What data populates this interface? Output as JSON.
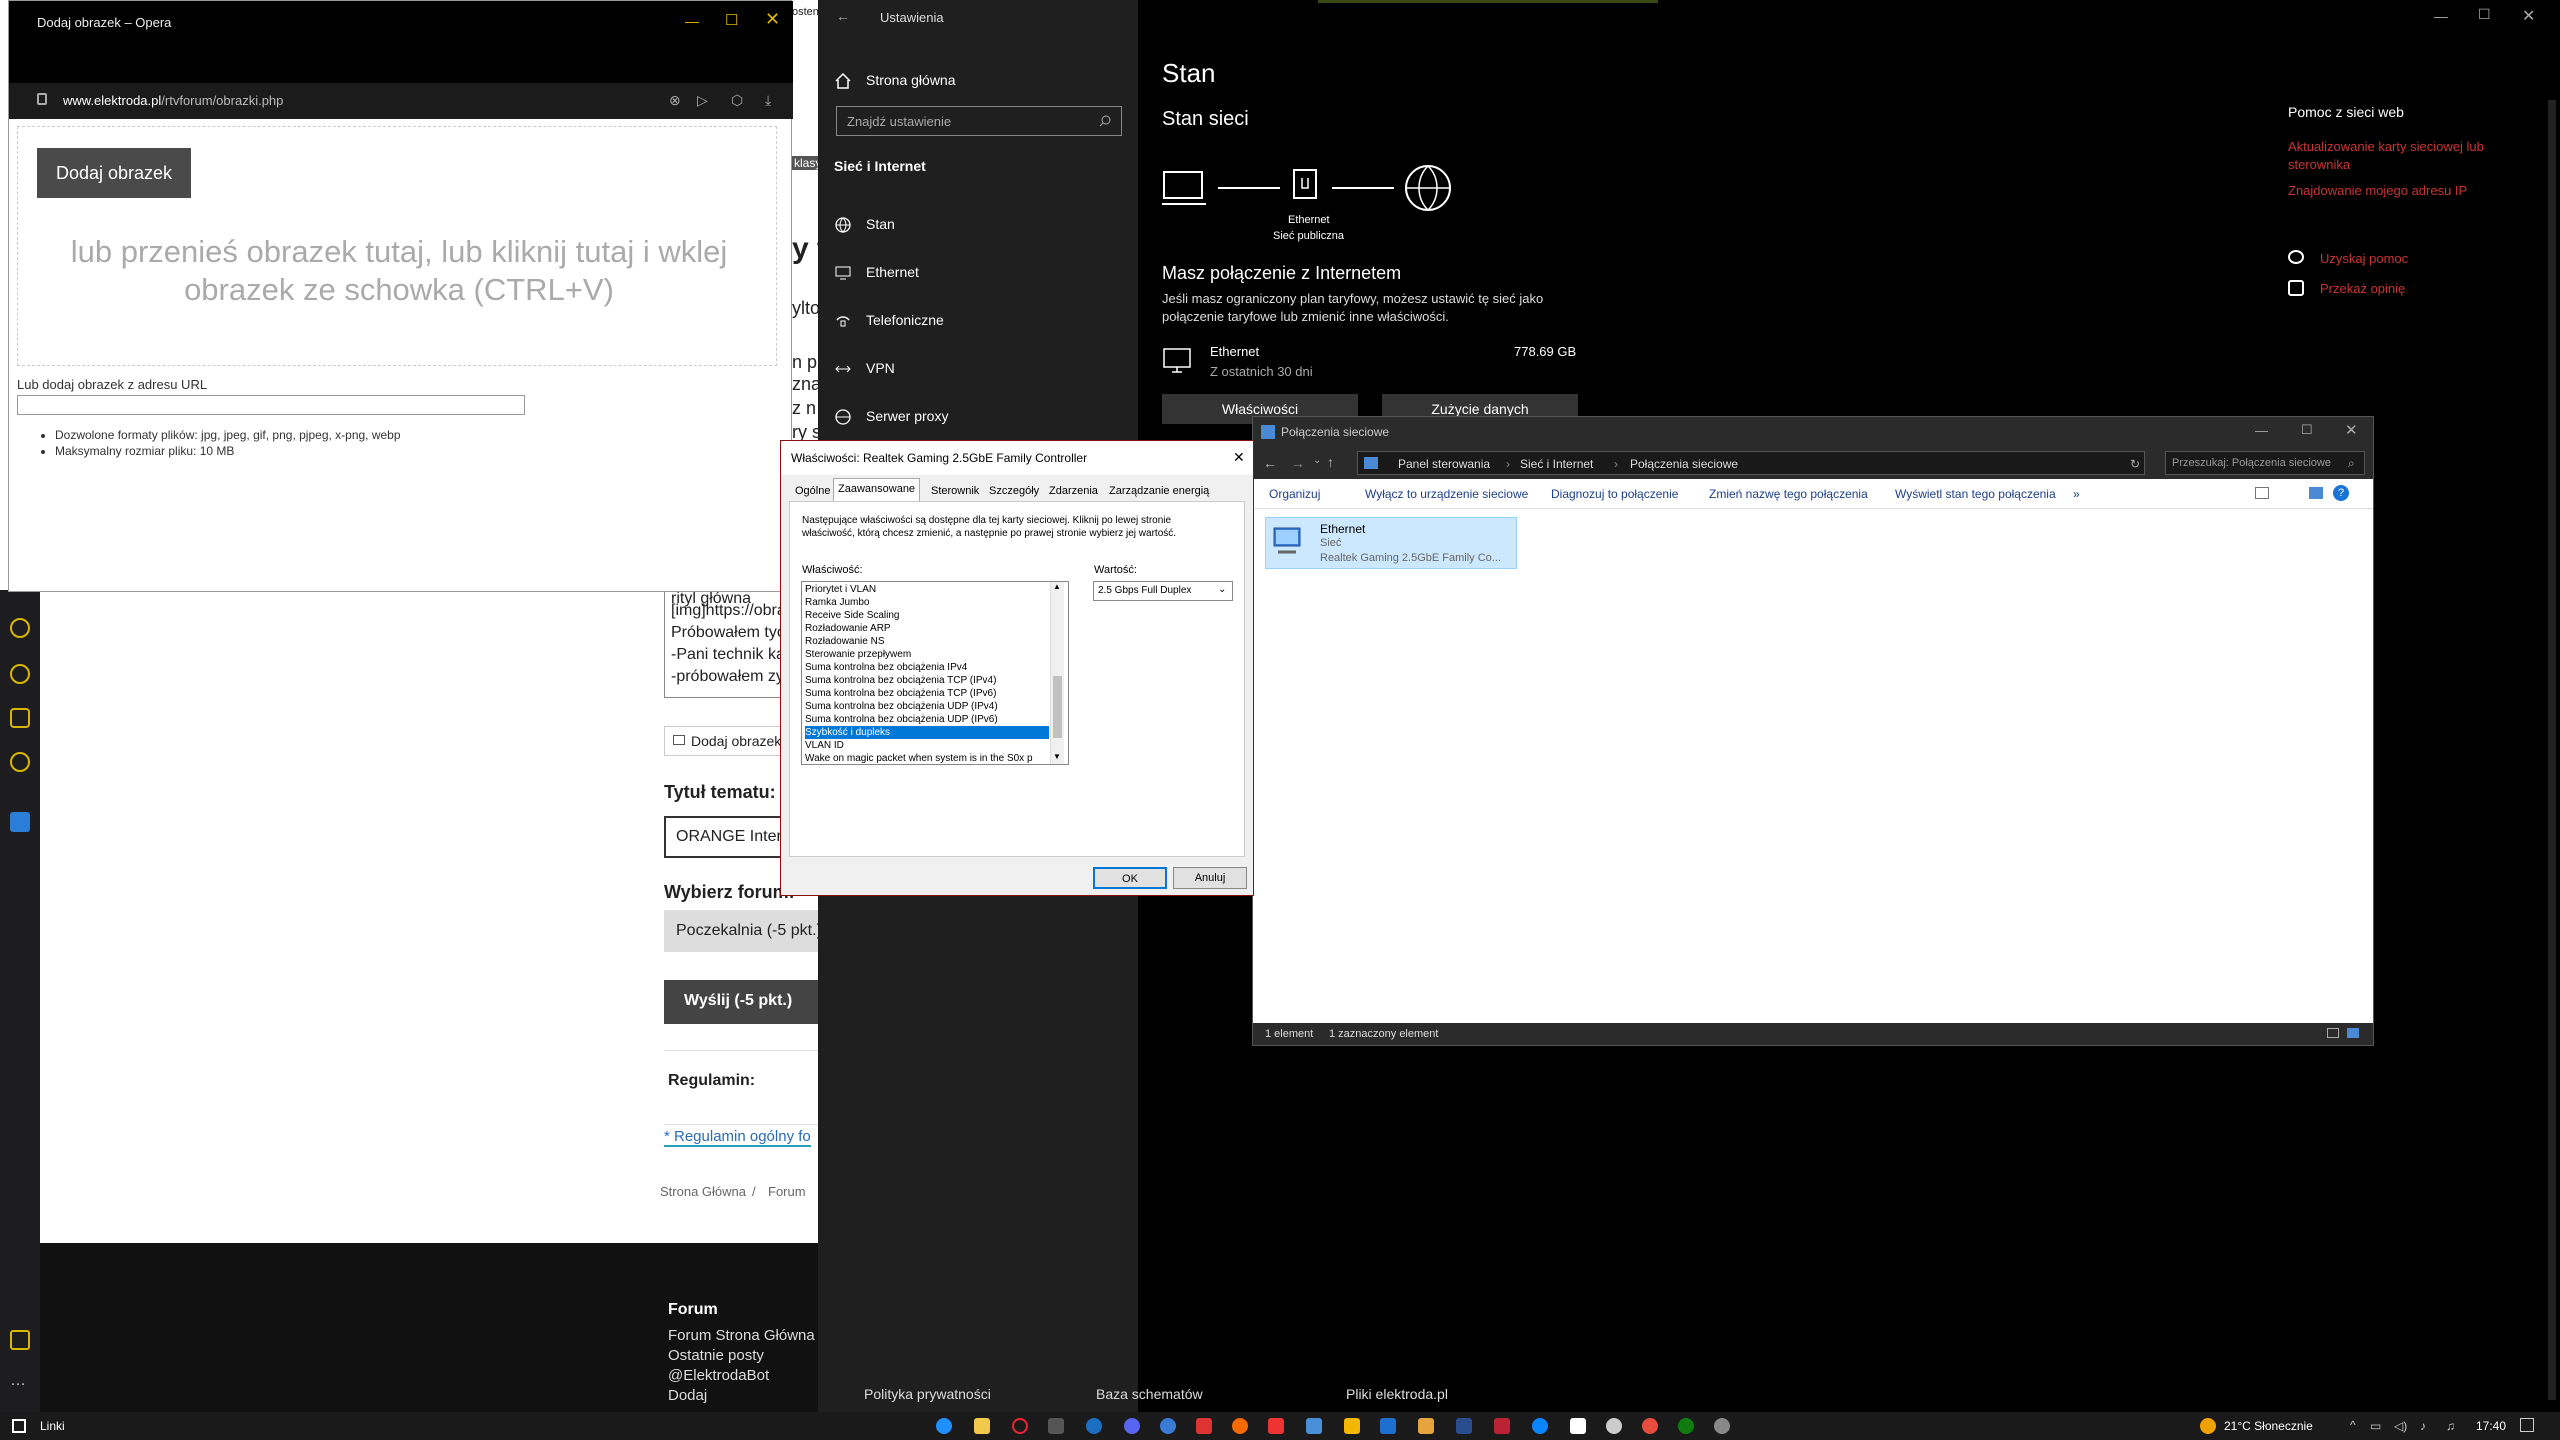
{
  "opera": {
    "title": "Dodaj obrazek – Opera",
    "url_domain": "www.elektroda.pl",
    "url_path": "/rtvforum/obrazki.php",
    "add_button": "Dodaj obrazek",
    "drop_text": "lub przenieś obrazek tutaj, lub kliknij tutaj i wklej obrazek ze schowka (CTRL+V)",
    "url_label": "Lub dodaj obrazek z adresu URL",
    "rules": [
      "Dozwolone formaty plików: jpg, jpeg, gif, png, pjpeg, x-png, webp",
      "Maksymalny rozmiar pliku: 10 MB"
    ]
  },
  "forum": {
    "fragments": [
      "osten t",
      "klasy",
      "y t",
      "ylto",
      "n pro",
      "znaj",
      "z n",
      "ry s",
      "rityl główna",
      "[img]https://obra",
      "Próbowałem tyo",
      "-Pani technik ka",
      "-próbowałem zy"
    ],
    "add_image": "Dodaj obrazek",
    "topic_label": "Tytuł tematu:",
    "topic_value": "ORANGE Inter",
    "forum_label": "Wybierz forum:",
    "forum_value": "Poczekalnia (-5 pkt.)",
    "send_button": "Wyślij (-5 pkt.)",
    "rules_label": "Regulamin:",
    "rules_link": "* Regulamin ogólny fo",
    "breadcrumb": [
      "Strona Główna",
      "/",
      "Forum"
    ],
    "footer_title": "Forum",
    "footer_links": [
      "Forum Strona Główna",
      "Ostatnie posty",
      "@ElektrodaBot",
      "Dodaj"
    ],
    "footer_more": [
      "Polityka prywatności",
      "Baza schematów",
      "Pliki elektroda.pl"
    ]
  },
  "settings": {
    "window_title": "Ustawienia",
    "home": "Strona główna",
    "search_placeholder": "Znajdź ustawienie",
    "section": "Sieć i Internet",
    "nav": [
      "Stan",
      "Ethernet",
      "Telefoniczne",
      "VPN",
      "Serwer proxy"
    ],
    "page_title": "Stan",
    "subtitle": "Stan sieci",
    "diagram_eth": "Ethernet",
    "diagram_net": "Sieć publiczna",
    "connected_title": "Masz połączenie z Internetem",
    "connected_desc": "Jeśli masz ograniczony plan taryfowy, możesz ustawić tę sieć jako połączenie taryfowe lub zmienić inne właściwości.",
    "eth_name": "Ethernet",
    "eth_period": "Z ostatnich 30 dni",
    "eth_usage": "778.69 GB",
    "btn_props": "Właściwości",
    "btn_usage": "Zużycie danych",
    "help_title": "Pomoc z sieci web",
    "help_links": [
      "Aktualizowanie karty sieciowej lub sterownika",
      "Znajdowanie mojego adresu IP"
    ],
    "get_help": "Uzyskaj pomoc",
    "feedback": "Przekaż opinię"
  },
  "props_dialog": {
    "title": "Właściwości: Realtek Gaming 2.5GbE Family Controller",
    "tabs": [
      "Ogólne",
      "Zaawansowane",
      "Sterownik",
      "Szczegóły",
      "Zdarzenia",
      "Zarządzanie energią"
    ],
    "description": "Następujące właściwości są dostępne dla tej karty sieciowej. Kliknij po lewej stronie właściwość, którą chcesz zmienić, a następnie po prawej stronie wybierz jej wartość.",
    "property_label": "Właściwość:",
    "value_label": "Wartość:",
    "properties": [
      "Priorytet i VLAN",
      "Ramka Jumbo",
      "Receive Side Scaling",
      "Rozładowanie ARP",
      "Rozładowanie NS",
      "Sterowanie przepływem",
      "Suma kontrolna bez obciążenia IPv4",
      "Suma kontrolna bez obciążenia TCP (IPv4)",
      "Suma kontrolna bez obciążenia TCP (IPv6)",
      "Suma kontrolna bez obciążenia UDP (IPv4)",
      "Suma kontrolna bez obciążenia UDP (IPv6)",
      "Szybkość i dupleks",
      "VLAN ID",
      "Wake on magic packet when system is in the S0x p"
    ],
    "selected_index": 11,
    "value": "2.5 Gbps Full Duplex",
    "ok": "OK",
    "cancel": "Anuluj"
  },
  "netconn": {
    "title": "Połączenia sieciowe",
    "breadcrumb": [
      "Panel sterowania",
      "Sieć i Internet",
      "Połączenia sieciowe"
    ],
    "search_placeholder": "Przeszukaj: Połączenia sieciowe",
    "commands": [
      "Organizuj",
      "Wyłącz to urządzenie sieciowe",
      "Diagnozuj to połączenie",
      "Zmień nazwę tego połączenia",
      "Wyświetl stan tego połączenia",
      "»"
    ],
    "item_name": "Ethernet",
    "item_type": "Sieć",
    "item_device": "Realtek Gaming 2.5GbE Family Co...",
    "status_count": "1 element",
    "status_selected": "1 zaznaczony element"
  },
  "taskbar": {
    "links": "Linki",
    "weather": "21°C Słonecznie",
    "time": "17:40"
  }
}
